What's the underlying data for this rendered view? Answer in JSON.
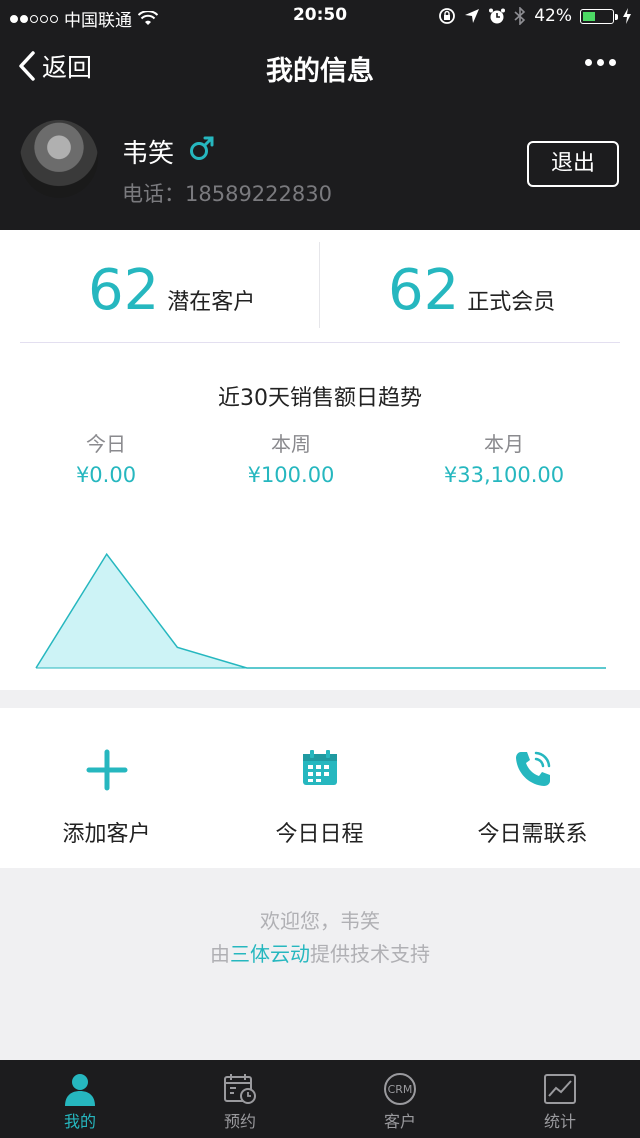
{
  "status_bar": {
    "carrier": "中国联通",
    "time": "20:50",
    "battery_percent": "42%"
  },
  "nav": {
    "back_label": "返回",
    "title": "我的信息"
  },
  "profile": {
    "name": "韦笑",
    "phone": "电话：18589222830",
    "logout_label": "退出"
  },
  "stats": [
    {
      "value": "62",
      "label": "潜在客户"
    },
    {
      "value": "62",
      "label": "正式会员"
    }
  ],
  "trend": {
    "title": "近30天销售额日趋势",
    "periods": [
      {
        "label": "今日",
        "value": "¥0.00"
      },
      {
        "label": "本周",
        "value": "¥100.00"
      },
      {
        "label": "本月",
        "value": "¥33,100.00"
      }
    ]
  },
  "chart_data": {
    "type": "area",
    "title": "近30天销售额日趋势",
    "values": [
      0,
      33000,
      6000,
      0,
      0,
      0,
      0,
      0,
      0,
      0,
      0
    ],
    "ylim": [
      0,
      40000
    ],
    "color": "#26b7bf",
    "fill": "#cdf3f6"
  },
  "actions": [
    {
      "label": "添加客户",
      "icon": "plus-icon"
    },
    {
      "label": "今日日程",
      "icon": "calendar-icon"
    },
    {
      "label": "今日需联系",
      "icon": "phone-icon"
    }
  ],
  "footer": {
    "welcome": "欢迎您，韦笑",
    "support_prefix": "由",
    "support_brand": "三体云动",
    "support_suffix": "提供技术支持"
  },
  "tabs": [
    {
      "label": "我的",
      "icon": "user-icon",
      "active": true
    },
    {
      "label": "预约",
      "icon": "calendar-clock-icon",
      "active": false
    },
    {
      "label": "客户",
      "icon": "crm-icon",
      "active": false
    },
    {
      "label": "统计",
      "icon": "chart-icon",
      "active": false
    }
  ],
  "colors": {
    "accent": "#26b7bf",
    "dark": "#1c1c1e"
  }
}
